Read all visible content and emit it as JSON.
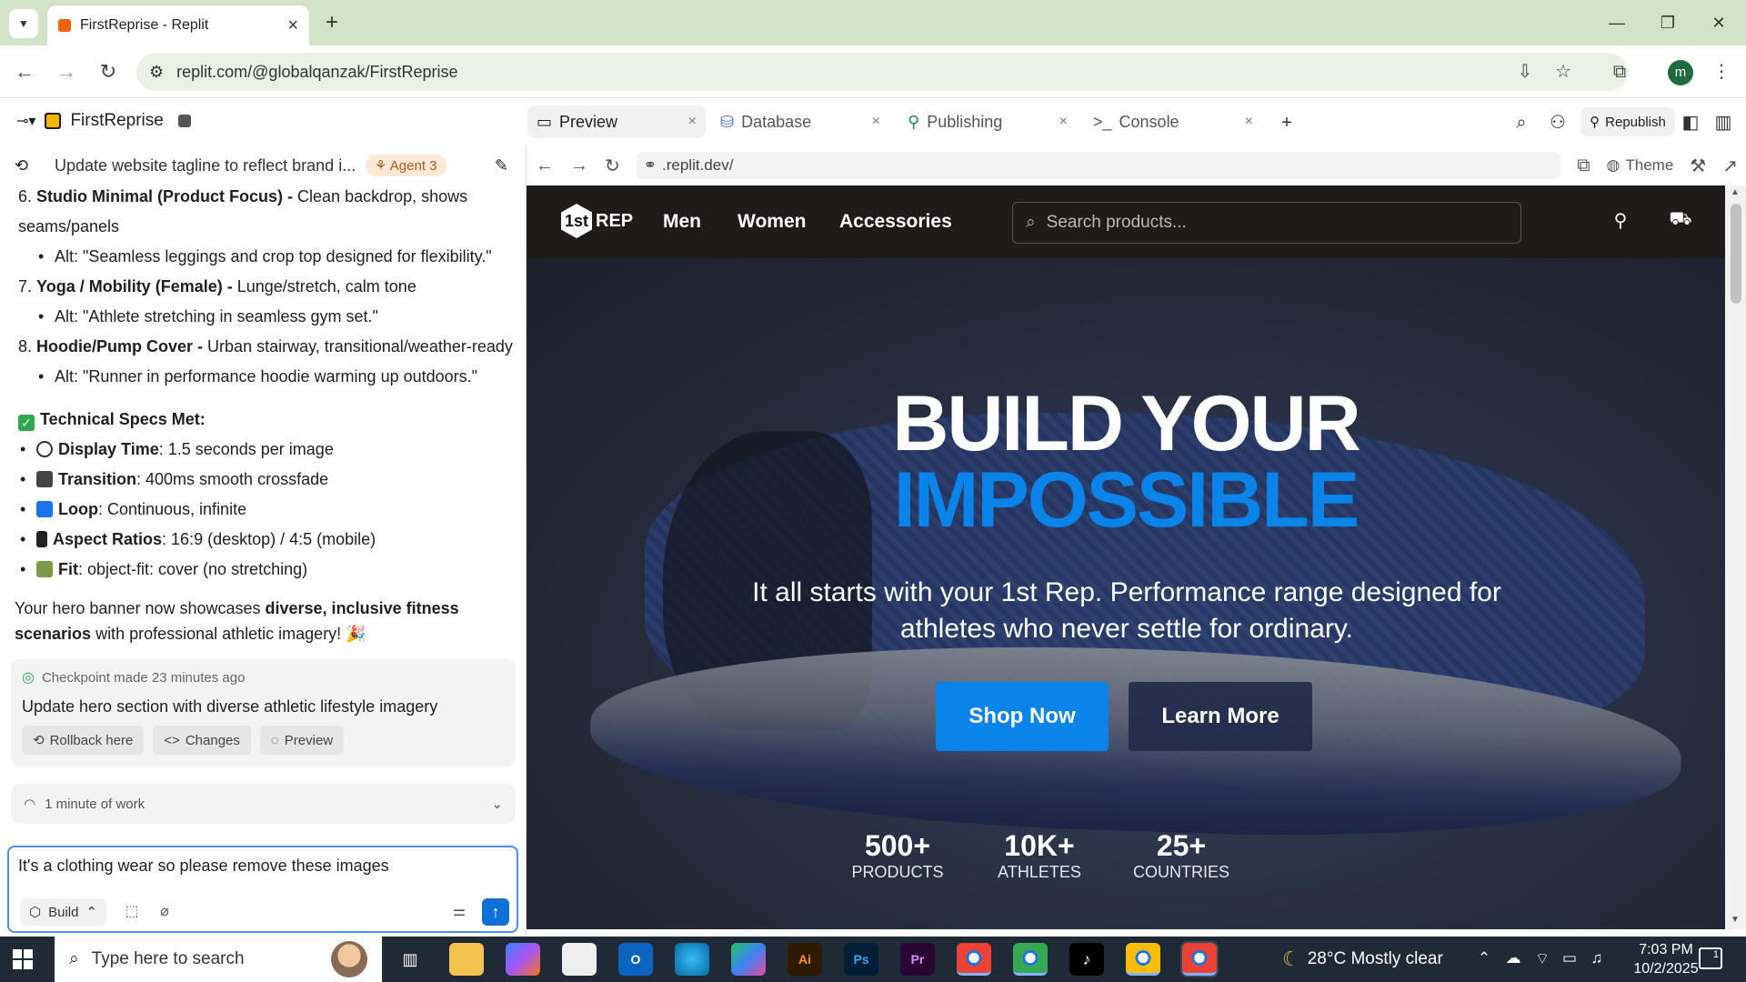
{
  "browser": {
    "tab_title": "FirstReprise - Replit",
    "url": "replit.com/@globalqanzak/FirstReprise",
    "profile_initial": "m"
  },
  "workspace": {
    "project_name": "FirstReprise",
    "tabs": [
      {
        "label": "Preview",
        "icon": "monitor-icon"
      },
      {
        "label": "Database",
        "icon": "database-icon"
      },
      {
        "label": "Publishing",
        "icon": "publishing-icon"
      },
      {
        "label": "Console",
        "icon": "terminal-icon"
      }
    ],
    "republish_label": "Republish"
  },
  "chat": {
    "title": "Update website tagline to reflect brand i...",
    "agent_badge": "Agent 3",
    "items": [
      {
        "num": "6.",
        "bold": "Studio Minimal (Product Focus) -",
        "text": " Clean backdrop, shows seams/panels",
        "alt": "Alt: \"Seamless leggings and crop top designed for flexibility.\""
      },
      {
        "num": "7.",
        "bold": "Yoga / Mobility (Female) -",
        "text": " Lunge/stretch, calm tone",
        "alt": "Alt: \"Athlete stretching in seamless gym set.\""
      },
      {
        "num": "8.",
        "bold": "Hoodie/Pump Cover -",
        "text": " Urban stairway, transitional/weather-ready",
        "alt": "Alt: \"Runner in performance hoodie warming up outdoors.\""
      }
    ],
    "specs_heading": "Technical Specs Met:",
    "specs": [
      {
        "bold": "Display Time",
        "text": ": 1.5 seconds per image",
        "icon": "stopwatch-icon",
        "color": "#333333"
      },
      {
        "bold": "Transition",
        "text": ": 400ms smooth crossfade",
        "icon": "clapper-icon",
        "color": "#444444"
      },
      {
        "bold": "Loop",
        "text": ": Continuous, infinite",
        "icon": "loop-icon",
        "color": "#1a73e8"
      },
      {
        "bold": "Aspect Ratios",
        "text": ": 16:9 (desktop) / 4:5 (mobile)",
        "icon": "phone-icon",
        "color": "#222222"
      },
      {
        "bold": "Fit",
        "text": ": object-fit: cover (no stretching)",
        "icon": "picture-icon",
        "color": "#7a9a4a"
      }
    ],
    "summary_pre": "Your hero banner now showcases ",
    "summary_bold": "diverse, inclusive fitness scenarios",
    "summary_post": " with professional athletic imagery! 🎉",
    "checkpoint": {
      "heading": "Checkpoint made 23 minutes ago",
      "description": "Update hero section with diverse athletic lifestyle imagery",
      "buttons": [
        "Rollback here",
        "Changes",
        "Preview"
      ]
    },
    "work_summary": "1 minute of work",
    "input_value": "It's a clothing wear so please remove these images",
    "build_label": "Build"
  },
  "preview": {
    "url": ".replit.dev/",
    "theme_label": "Theme",
    "site": {
      "logo_text": "REP",
      "logo_badge": "1st",
      "nav_links": [
        "Men",
        "Women",
        "Accessories"
      ],
      "search_placeholder": "Search products...",
      "hero_line1": "BUILD YOUR",
      "hero_line2": "IMPOSSIBLE",
      "hero_sub": "It all starts with your 1st Rep. Performance range designed for athletes who never settle for ordinary.",
      "shop_now": "Shop Now",
      "learn_more": "Learn More",
      "stats": [
        {
          "value": "500+",
          "label": "PRODUCTS"
        },
        {
          "value": "10K+",
          "label": "ATHLETES"
        },
        {
          "value": "25+",
          "label": "COUNTRIES"
        }
      ],
      "accent_color": "#0a84e8"
    }
  },
  "taskbar": {
    "search_placeholder": "Type here to search",
    "apps": [
      "task-view",
      "file-explorer",
      "copilot",
      "microsoft-store",
      "outlook",
      "edge",
      "m365",
      "illustrator",
      "photoshop",
      "premiere",
      "chrome",
      "chrome",
      "tiktok",
      "chrome",
      "chrome"
    ],
    "weather": "28°C  Mostly clear",
    "time": "7:03 PM",
    "date": "10/2/2025",
    "notification_count": "1"
  }
}
